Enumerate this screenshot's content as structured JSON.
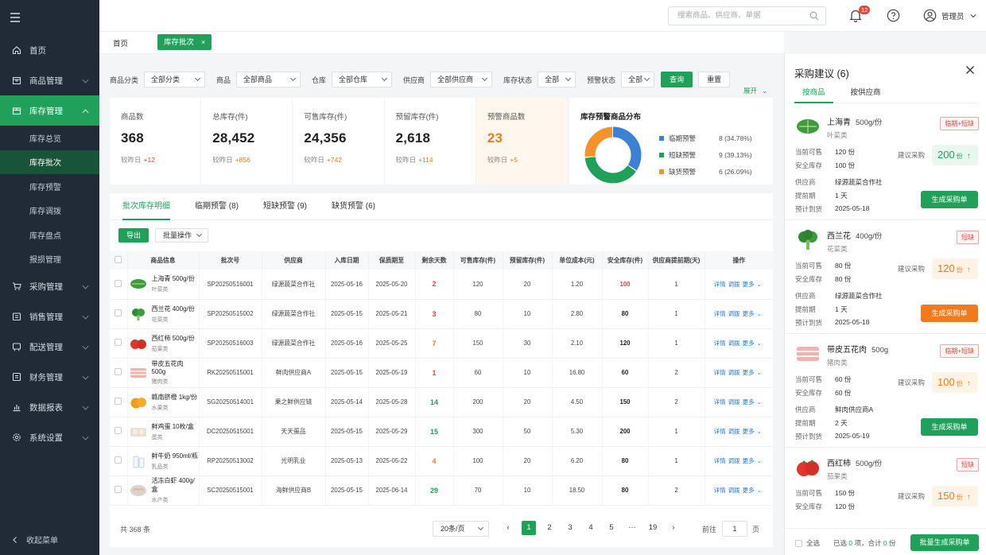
{
  "sidebar": {
    "items": [
      {
        "label": "首页"
      },
      {
        "label": "商品管理"
      },
      {
        "label": "库存管理"
      },
      {
        "label": "采购管理"
      },
      {
        "label": "销售管理"
      },
      {
        "label": "配送管理"
      },
      {
        "label": "财务管理"
      },
      {
        "label": "数据报表"
      },
      {
        "label": "系统设置"
      }
    ],
    "subitems": [
      "库存总览",
      "库存批次",
      "库存预警",
      "库存调拨",
      "库存盘点",
      "报损管理"
    ],
    "collapse": "收起菜单"
  },
  "header": {
    "search_placeholder": "搜索商品、供应商、单据",
    "notif_count": "12",
    "user": "管理员"
  },
  "tabs": {
    "home": "首页",
    "current": "库存批次"
  },
  "filters": [
    {
      "label": "商品分类",
      "value": "全部分类"
    },
    {
      "label": "商品",
      "value": "全部商品"
    },
    {
      "label": "仓库",
      "value": "全部仓库"
    },
    {
      "label": "供应商",
      "value": "全部供应商"
    },
    {
      "label": "库存状态",
      "value": "全部"
    },
    {
      "label": "预警状态",
      "value": "全部"
    }
  ],
  "filter_buttons": {
    "query": "查询",
    "reset": "重置",
    "expand": "展开"
  },
  "stats": [
    {
      "label": "商品数",
      "value": "368",
      "cmp_label": "较昨日",
      "delta": "+12"
    },
    {
      "label": "总库存(件)",
      "value": "28,452",
      "cmp_label": "较昨日",
      "delta": "+856"
    },
    {
      "label": "可售库存(件)",
      "value": "24,356",
      "cmp_label": "较昨日",
      "delta": "+742"
    },
    {
      "label": "预留库存(件)",
      "value": "2,618",
      "cmp_label": "较昨日",
      "delta": "+114"
    },
    {
      "label": "预警商品数",
      "value": "23",
      "cmp_label": "较昨日",
      "delta": "+5"
    }
  ],
  "chart_data": {
    "type": "pie",
    "title": "库存预警商品分布",
    "labels": [
      "临期预警",
      "短缺预警",
      "缺货预警"
    ],
    "values": [
      8,
      9,
      6
    ],
    "value_labels": [
      "8 (34.78%)",
      "9 (39.13%)",
      "6 (26.09%)"
    ],
    "colors": [
      "#3b82d6",
      "#1fa15a",
      "#f5922b"
    ],
    "legend": "right"
  },
  "list": {
    "tabs": [
      "批次库存明细",
      "临期预警 (8)",
      "短缺预警 (9)",
      "缺货预警 (6)"
    ],
    "export": "导出",
    "batch": "批量操作",
    "columns": [
      "商品信息",
      "批次号",
      "供应商",
      "入库日期",
      "保质期至",
      "剩余天数",
      "可售库存(件)",
      "预留库存(件)",
      "单位成本(元)",
      "安全库存(件)",
      "供应商提前期(天)",
      "操作"
    ],
    "rows": [
      {
        "name": "上海青 500g/份",
        "cat": "叶菜类",
        "batch": "SP20250516001",
        "supplier": "绿源蔬菜合作社",
        "in": "2025-05-16",
        "exp": "2025-05-20",
        "days": "2",
        "sale": "120",
        "res": "20",
        "cost": "1.20",
        "safe": "100",
        "lead": "1"
      },
      {
        "name": "西兰花 400g/份",
        "cat": "花菜类",
        "batch": "SP20250515002",
        "supplier": "绿源蔬菜合作社",
        "in": "2025-05-15",
        "exp": "2025-05-21",
        "days": "3",
        "sale": "80",
        "res": "10",
        "cost": "2.80",
        "safe": "80",
        "lead": "1"
      },
      {
        "name": "西红柿 500g/份",
        "cat": "茄果类",
        "batch": "SP20250516003",
        "supplier": "绿源蔬菜合作社",
        "in": "2025-05-16",
        "exp": "2025-05-25",
        "days": "7",
        "sale": "150",
        "res": "30",
        "cost": "2.10",
        "safe": "120",
        "lead": "1"
      },
      {
        "name": "带皮五花肉 500g",
        "cat": "猪肉类",
        "batch": "RK20250515001",
        "supplier": "鲜肉供应商A",
        "in": "2025-05-15",
        "exp": "2025-05-19",
        "days": "1",
        "sale": "60",
        "res": "10",
        "cost": "16.80",
        "safe": "60",
        "lead": "2"
      },
      {
        "name": "赣南脐橙 1kg/份",
        "cat": "水果类",
        "batch": "SG20250514001",
        "supplier": "果之鲜供应链",
        "in": "2025-05-14",
        "exp": "2025-05-28",
        "days": "14",
        "sale": "200",
        "res": "20",
        "cost": "4.50",
        "safe": "150",
        "lead": "2"
      },
      {
        "name": "鲜鸡蛋 10枚/盒",
        "cat": "蛋类",
        "batch": "DC20250515001",
        "supplier": "天天蛋品",
        "in": "2025-05-15",
        "exp": "2025-05-29",
        "days": "15",
        "sale": "300",
        "res": "50",
        "cost": "5.30",
        "safe": "200",
        "lead": "1"
      },
      {
        "name": "鲜牛奶 950ml/瓶",
        "cat": "乳品类",
        "batch": "RP20250513002",
        "supplier": "光明乳业",
        "in": "2025-05-13",
        "exp": "2025-05-22",
        "days": "4",
        "sale": "100",
        "res": "20",
        "cost": "6.20",
        "safe": "80",
        "lead": "1"
      },
      {
        "name": "活冻白虾 400g/盒",
        "cat": "水产类",
        "batch": "SC20250515001",
        "supplier": "海鲜供应商B",
        "in": "2025-05-15",
        "exp": "2025-06-14",
        "days": "29",
        "sale": "70",
        "res": "10",
        "cost": "18.50",
        "safe": "80",
        "lead": "2"
      }
    ],
    "ops": [
      "详情",
      "调拨",
      "更多"
    ],
    "total": "共 368 条",
    "page_size": "20条/页",
    "pages": [
      "1",
      "2",
      "3",
      "4",
      "5",
      "···",
      "19"
    ],
    "goto": "前往",
    "goto_val": "1",
    "goto_suffix": "页"
  },
  "panel": {
    "title": "采购建议 (6)",
    "tabs": [
      "按商品",
      "按供应商"
    ],
    "k_cur": "当前可售",
    "k_safe": "安全库存",
    "k_sup": "供应商",
    "k_lead": "提前期",
    "k_eta": "预计到货",
    "k_sugg": "建议采购",
    "gen": "生成采购单",
    "cards": [
      {
        "name": "上海青",
        "spec": "500g/份",
        "cat": "叶菜类",
        "tag": "临期+短缺",
        "cur": "120 份",
        "safe": "100 份",
        "sugg": "200",
        "unit": "份",
        "sup": "绿源蔬菜合作社",
        "lead": "1 天",
        "eta": "2025-05-18"
      },
      {
        "name": "西兰花",
        "spec": "400g/份",
        "cat": "花菜类",
        "tag": "短缺",
        "cur": "80 份",
        "safe": "80 份",
        "sugg": "120",
        "unit": "份",
        "sup": "绿源蔬菜合作社",
        "lead": "1 天",
        "eta": "2025-05-18"
      },
      {
        "name": "带皮五花肉",
        "spec": "500g",
        "cat": "猪肉类",
        "tag": "临期+短缺",
        "cur": "60 份",
        "safe": "60 份",
        "sugg": "100",
        "unit": "份",
        "sup": "鲜肉供应商A",
        "lead": "2 天",
        "eta": "2025-05-19"
      },
      {
        "name": "西红柿",
        "spec": "500g/份",
        "cat": "茄果类",
        "tag": "短缺",
        "cur": "150 份",
        "safe": "120 份",
        "sugg": "150",
        "unit": "份"
      }
    ],
    "select_all": "全选",
    "sel_prefix": "已选",
    "sel_count": "0",
    "sel_mid": "项，合计",
    "sel_total": "0",
    "sel_unit": "份",
    "batch_gen": "批量生成采购单"
  }
}
